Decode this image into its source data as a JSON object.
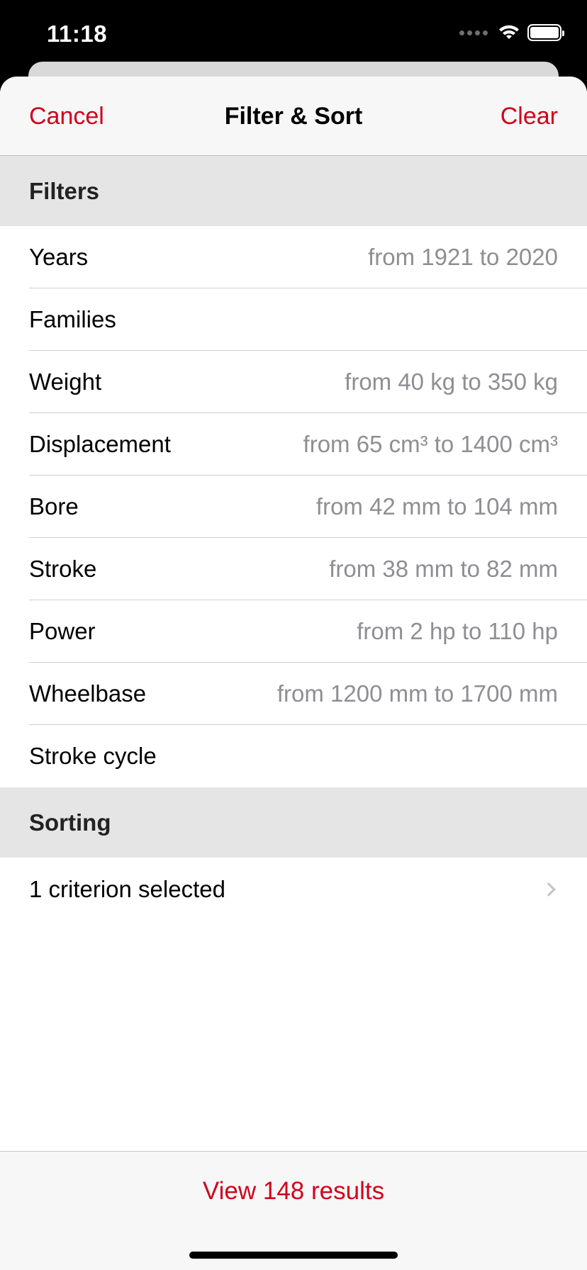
{
  "status_bar": {
    "time": "11:18"
  },
  "nav": {
    "cancel_label": "Cancel",
    "title": "Filter & Sort",
    "clear_label": "Clear"
  },
  "filters": {
    "header": "Filters",
    "items": [
      {
        "label": "Years",
        "value": "from 1921 to 2020"
      },
      {
        "label": "Families",
        "value": ""
      },
      {
        "label": "Weight",
        "value": "from 40 kg to 350 kg"
      },
      {
        "label": "Displacement",
        "value": "from 65 cm³ to 1400 cm³"
      },
      {
        "label": "Bore",
        "value": "from 42 mm to 104 mm"
      },
      {
        "label": "Stroke",
        "value": "from 38 mm to 82 mm"
      },
      {
        "label": "Power",
        "value": "from 2 hp to 110 hp"
      },
      {
        "label": "Wheelbase",
        "value": "from 1200 mm to 1700 mm"
      },
      {
        "label": "Stroke cycle",
        "value": ""
      }
    ]
  },
  "sorting": {
    "header": "Sorting",
    "summary": "1 criterion selected"
  },
  "footer": {
    "view_results_label": "View 148 results"
  },
  "colors": {
    "accent": "#d0021b",
    "secondary_text": "#8e8e93",
    "section_bg": "#e5e5e5"
  },
  "icons": {
    "wifi": "wifi-icon",
    "battery": "battery-icon",
    "signal": "cellular-signal-icon",
    "chevron": "chevron-right-icon"
  }
}
